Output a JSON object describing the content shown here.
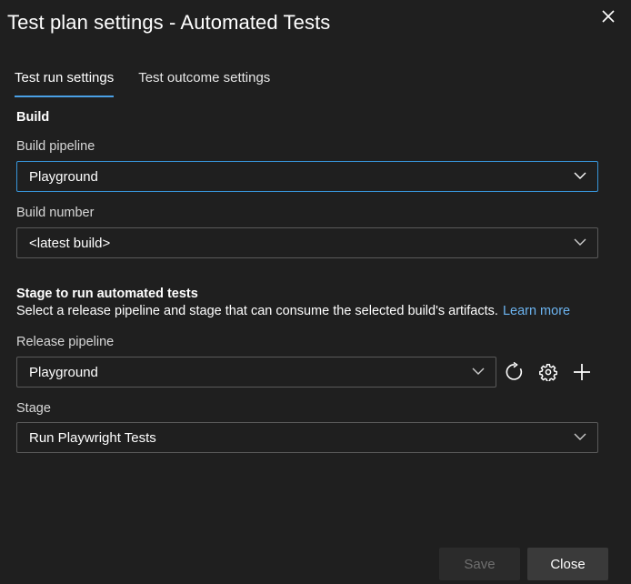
{
  "dialog": {
    "title": "Test plan settings - Automated Tests",
    "close_icon": "close-icon"
  },
  "tabs": [
    {
      "label": "Test run settings",
      "active": true
    },
    {
      "label": "Test outcome settings",
      "active": false
    }
  ],
  "build": {
    "heading": "Build",
    "pipeline": {
      "label": "Build pipeline",
      "value": "Playground",
      "icon": "chevron-down-icon"
    },
    "number": {
      "label": "Build number",
      "value": "<latest build>",
      "icon": "chevron-down-icon"
    }
  },
  "stage_section": {
    "heading": "Stage to run automated tests",
    "description": "Select a release pipeline and stage that can consume the selected build's artifacts.",
    "learn_more": "Learn more",
    "release_pipeline": {
      "label": "Release pipeline",
      "value": "Playground",
      "icon": "chevron-down-icon"
    },
    "release_actions": [
      {
        "name": "refresh-icon"
      },
      {
        "name": "gear-icon"
      },
      {
        "name": "plus-icon"
      }
    ],
    "stage": {
      "label": "Stage",
      "value": "Run Playwright Tests",
      "icon": "chevron-down-icon"
    }
  },
  "footer": {
    "save_label": "Save",
    "save_enabled": false,
    "close_label": "Close"
  },
  "colors": {
    "background": "#1f1f1f",
    "accent": "#4aa0e6",
    "link": "#6cb4f0",
    "field_border": "#5a5a5a",
    "focused_border": "#3794d8"
  }
}
